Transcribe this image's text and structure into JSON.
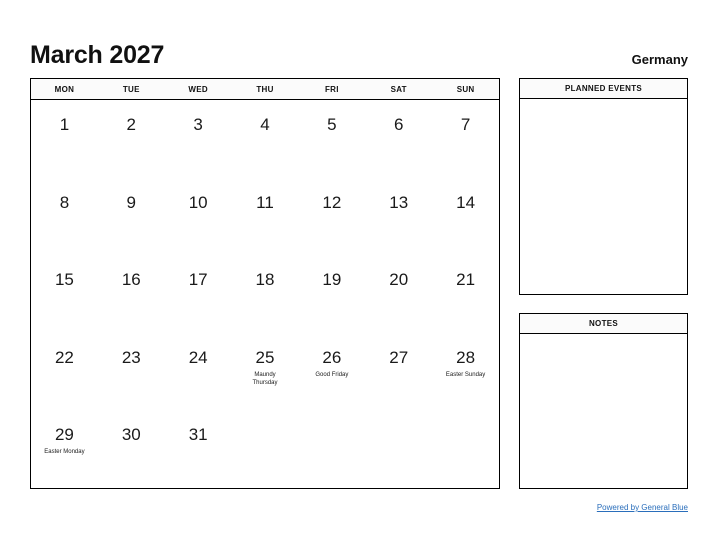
{
  "header": {
    "title": "March 2027",
    "region": "Germany"
  },
  "calendar": {
    "weekdays": [
      "MON",
      "TUE",
      "WED",
      "THU",
      "FRI",
      "SAT",
      "SUN"
    ],
    "weeks": [
      [
        {
          "day": "1",
          "holiday": ""
        },
        {
          "day": "2",
          "holiday": ""
        },
        {
          "day": "3",
          "holiday": ""
        },
        {
          "day": "4",
          "holiday": ""
        },
        {
          "day": "5",
          "holiday": ""
        },
        {
          "day": "6",
          "holiday": ""
        },
        {
          "day": "7",
          "holiday": ""
        }
      ],
      [
        {
          "day": "8",
          "holiday": ""
        },
        {
          "day": "9",
          "holiday": ""
        },
        {
          "day": "10",
          "holiday": ""
        },
        {
          "day": "11",
          "holiday": ""
        },
        {
          "day": "12",
          "holiday": ""
        },
        {
          "day": "13",
          "holiday": ""
        },
        {
          "day": "14",
          "holiday": ""
        }
      ],
      [
        {
          "day": "15",
          "holiday": ""
        },
        {
          "day": "16",
          "holiday": ""
        },
        {
          "day": "17",
          "holiday": ""
        },
        {
          "day": "18",
          "holiday": ""
        },
        {
          "day": "19",
          "holiday": ""
        },
        {
          "day": "20",
          "holiday": ""
        },
        {
          "day": "21",
          "holiday": ""
        }
      ],
      [
        {
          "day": "22",
          "holiday": ""
        },
        {
          "day": "23",
          "holiday": ""
        },
        {
          "day": "24",
          "holiday": ""
        },
        {
          "day": "25",
          "holiday": "Maundy\nThursday"
        },
        {
          "day": "26",
          "holiday": "Good Friday"
        },
        {
          "day": "27",
          "holiday": ""
        },
        {
          "day": "28",
          "holiday": "Easter Sunday"
        }
      ],
      [
        {
          "day": "29",
          "holiday": "Easter Monday"
        },
        {
          "day": "30",
          "holiday": ""
        },
        {
          "day": "31",
          "holiday": ""
        },
        {
          "day": "",
          "holiday": ""
        },
        {
          "day": "",
          "holiday": ""
        },
        {
          "day": "",
          "holiday": ""
        },
        {
          "day": "",
          "holiday": ""
        }
      ]
    ]
  },
  "panels": {
    "planned_events_title": "PLANNED EVENTS",
    "notes_title": "NOTES"
  },
  "footer": {
    "link_text": "Powered by General Blue",
    "link_color": "#2a6ebb"
  }
}
